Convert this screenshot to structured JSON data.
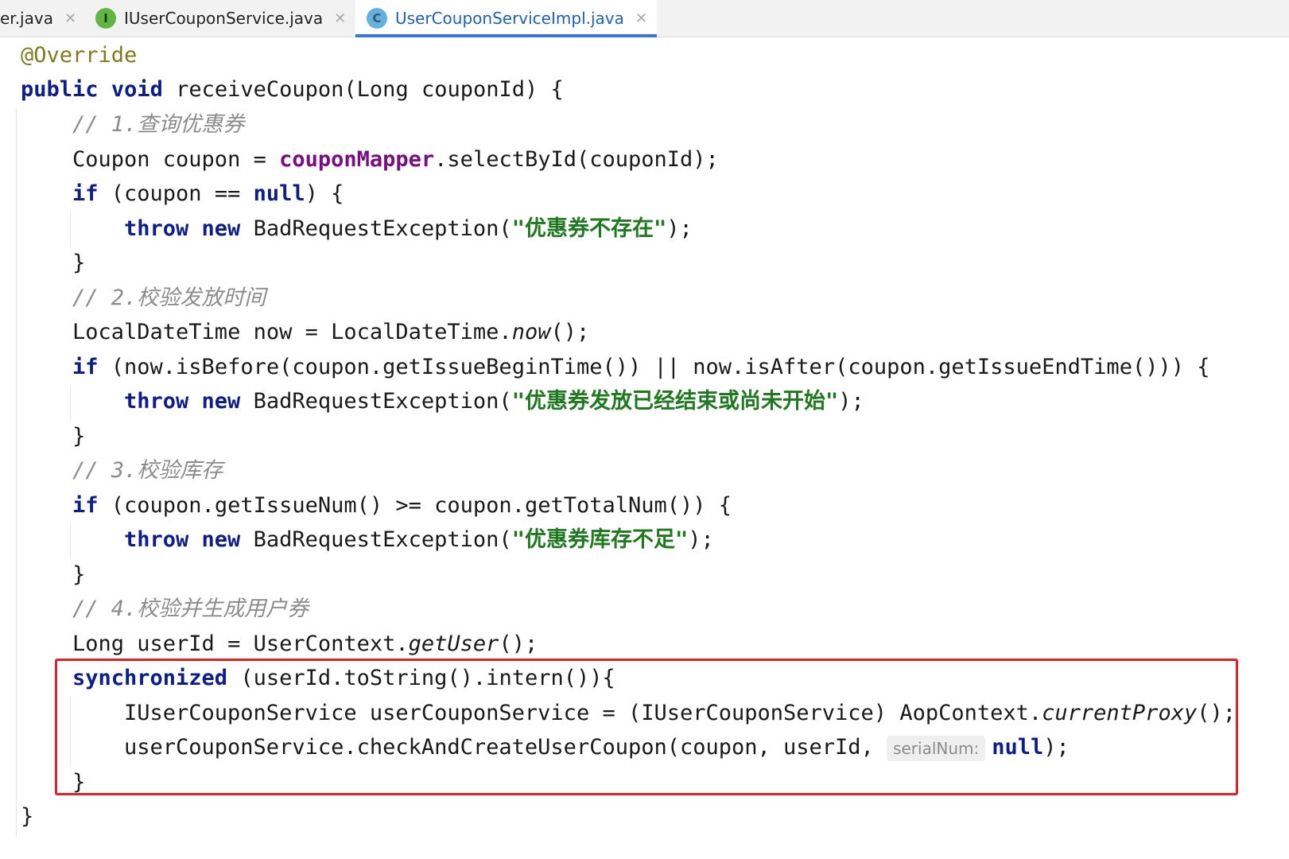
{
  "tabs": [
    {
      "label": "er.java",
      "icon": "",
      "active": false
    },
    {
      "label": "IUserCouponService.java",
      "icon": "I",
      "active": false
    },
    {
      "label": "UserCouponServiceImpl.java",
      "icon": "C",
      "active": true
    }
  ],
  "code": {
    "annotation": "@Override",
    "sig_kw1": "public",
    "sig_kw2": "void",
    "sig_rest": " receiveCoupon(Long couponId) {",
    "c1": "// 1.查询优惠券",
    "l_coupon_a": "Coupon coupon = ",
    "l_coupon_field": "couponMapper",
    "l_coupon_b": ".selectById(couponId);",
    "if_kw": "if",
    "if1_a": " (coupon == ",
    "null_kw": "null",
    "if1_b": ") {",
    "throw_kw": "throw",
    "new_kw": "new",
    "bre": " BadRequestException(",
    "s1": "\"优惠券不存在\"",
    "end_paren": ");",
    "close_brace": "}",
    "c2": "// 2.校验发放时间",
    "l_now_a": "LocalDateTime now = LocalDateTime.",
    "l_now_m": "now",
    "l_now_b": "();",
    "if2_rest": " (now.isBefore(coupon.getIssueBeginTime()) || now.isAfter(coupon.getIssueEndTime())) {",
    "s2": "\"优惠券发放已经结束或尚未开始\"",
    "c3": "// 3.校验库存",
    "if3_rest": " (coupon.getIssueNum() >= coupon.getTotalNum()) {",
    "s3": "\"优惠券库存不足\"",
    "c4": "// 4.校验并生成用户券",
    "l_user_a": "Long userId = UserContext.",
    "l_user_m": "getUser",
    "l_user_b": "();",
    "sync_kw": "synchronized",
    "sync_rest": " (userId.toString().intern()){",
    "proxy_a": "IUserCouponService userCouponService = (IUserCouponService) AopContext.",
    "proxy_m": "currentProxy",
    "proxy_b": "();",
    "call_a": "userCouponService.checkAndCreateUserCoupon(coupon, userId, ",
    "hint": "serialNum:",
    "call_b": ");"
  }
}
